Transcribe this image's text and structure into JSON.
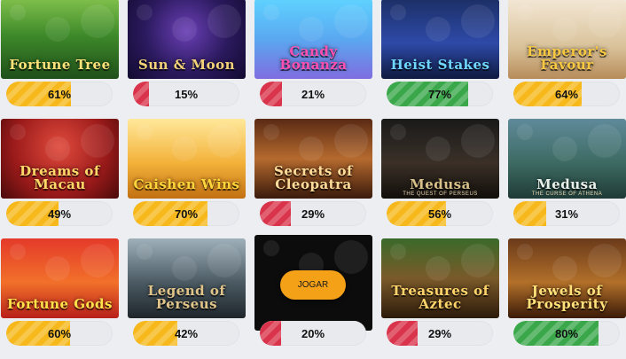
{
  "games": [
    {
      "title": "Fortune Tree",
      "percent": "61%",
      "fill": 0.61,
      "bar_color": "#f6b81b",
      "bg": "linear-gradient(180deg,#7fbf4b 0%,#3e8a2a 45%,#1f4f1a 100%)",
      "title_color": "#ffe27a"
    },
    {
      "title": "Sun & Moon",
      "percent": "15%",
      "fill": 0.15,
      "bar_color": "#d9344b",
      "bg": "radial-gradient(circle at 50% 40%,#6a3fb5 0%,#2b1a5e 55%,#120a30 100%)",
      "title_color": "#f3d27a"
    },
    {
      "title": "Candy Bonanza",
      "percent": "21%",
      "fill": 0.21,
      "bar_color": "#d9344b",
      "bg": "linear-gradient(180deg,#5fd2ff 0%,#5aa8f0 50%,#7f6de0 100%)",
      "title_color": "#ff4fb0"
    },
    {
      "title": "Heist Stakes",
      "percent": "77%",
      "fill": 0.77,
      "bar_color": "#3aa84a",
      "bg": "linear-gradient(180deg,#1c2f66 0%,#2e4aa8 55%,#0f1a40 100%)",
      "title_color": "#6fd7ff"
    },
    {
      "title": "Emperor's Favour",
      "percent": "64%",
      "fill": 0.64,
      "bar_color": "#f6b81b",
      "bg": "linear-gradient(180deg,#f3e7d4 0%,#d9c29a 60%,#b78c5a 100%)",
      "title_color": "#f7c840"
    },
    {
      "title": "Dreams of Macau",
      "percent": "49%",
      "fill": 0.49,
      "bar_color": "#f6b81b",
      "bg": "radial-gradient(circle at 50% 35%,#e04a3c 0%,#9a1a1a 60%,#4a0a0a 100%)",
      "title_color": "#ffd86a"
    },
    {
      "title": "Caishen Wins",
      "percent": "70%",
      "fill": 0.7,
      "bar_color": "#f6b81b",
      "bg": "linear-gradient(180deg,#ffe89a 0%,#f3b23a 55%,#c27012 100%)",
      "title_color": "#ffd53a"
    },
    {
      "title": "Secrets of Cleopatra",
      "percent": "29%",
      "fill": 0.29,
      "bar_color": "#d9344b",
      "bg": "linear-gradient(180deg,#5a2a14 0%,#b56a2e 50%,#3a1a0c 100%)",
      "title_color": "#ffdc9a"
    },
    {
      "title": "Medusa",
      "subtitle": "THE QUEST OF PERSEUS",
      "percent": "56%",
      "fill": 0.56,
      "bar_color": "#f6b81b",
      "bg": "linear-gradient(180deg,#1a1a1a 0%,#3a3028 55%,#120e0a 100%)",
      "title_color": "#d8c08a"
    },
    {
      "title": "Medusa",
      "subtitle": "THE CURSE OF ATHENA",
      "percent": "31%",
      "fill": 0.31,
      "bar_color": "#f6b81b",
      "bg": "linear-gradient(180deg,#5f8a9a 0%,#3d6b63 55%,#1f3a36 100%)",
      "title_color": "#e8f0ea"
    },
    {
      "title": "Fortune Gods",
      "percent": "60%",
      "fill": 0.6,
      "bar_color": "#f6b81b",
      "bg": "linear-gradient(180deg,#e43a2a 0%,#f2702a 55%,#b8201a 100%)",
      "title_color": "#ffe14a"
    },
    {
      "title": "Legend of Perseus",
      "percent": "42%",
      "fill": 0.42,
      "bar_color": "#f6b81b",
      "bg": "linear-gradient(180deg,#9fb0ba 0%,#4b5a63 55%,#1e262b 100%)",
      "title_color": "#e0c48a"
    },
    {
      "title": "",
      "percent": "20%",
      "fill": 0.2,
      "bar_color": "#d9344b",
      "bg": "#0c0c0c",
      "play_label": "JOGAR"
    },
    {
      "title": "Treasures of Aztec",
      "percent": "29%",
      "fill": 0.29,
      "bar_color": "#d9344b",
      "bg": "linear-gradient(180deg,#3a6a2a 0%,#7a5a2a 50%,#2c1a0a 100%)",
      "title_color": "#ffd46a"
    },
    {
      "title": "Jewels of Prosperity",
      "percent": "80%",
      "fill": 0.8,
      "bar_color": "#3aa84a",
      "bg": "linear-gradient(180deg,#6a3a1a 0%,#b2702a 55%,#3a1a08 100%)",
      "title_color": "#ffe07a"
    }
  ]
}
